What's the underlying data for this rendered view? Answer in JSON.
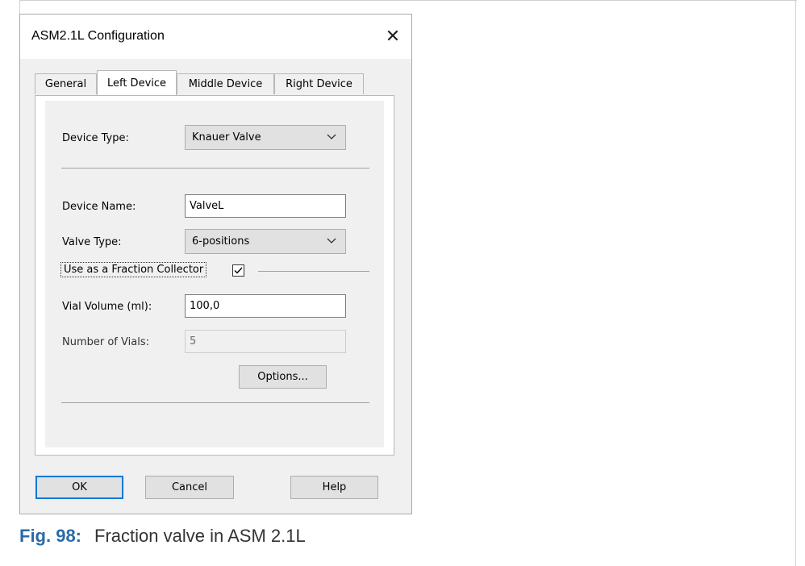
{
  "dialog": {
    "title": "ASM2.1L Configuration",
    "close_glyph": "✕"
  },
  "tabs": [
    {
      "label": "General",
      "active": false
    },
    {
      "label": "Left Device",
      "active": true
    },
    {
      "label": "Middle Device",
      "active": false
    },
    {
      "label": "Right Device",
      "active": false
    }
  ],
  "form": {
    "device_type": {
      "label": "Device Type:",
      "value": "Knauer Valve"
    },
    "device_name": {
      "label": "Device Name:",
      "value": "ValveL"
    },
    "valve_type": {
      "label": "Valve Type:",
      "value": "6-positions"
    },
    "fraction_collector": {
      "label": "Use as a Fraction Collector",
      "checked": true
    },
    "vial_volume": {
      "label": "Vial Volume (ml):",
      "value": "100,0"
    },
    "number_of_vials": {
      "label": "Number of Vials:",
      "value": "5",
      "disabled": true
    },
    "options_label": "Options..."
  },
  "buttons": {
    "ok": "OK",
    "cancel": "Cancel",
    "help": "Help"
  },
  "caption": {
    "number": "Fig. 98:",
    "text": "Fraction valve in ASM 2.1L"
  },
  "colors": {
    "accent": "#0078d7",
    "caption_blue": "#2b6aa6"
  },
  "icons": {
    "close": "close-icon",
    "dropdown": "chevron-down-icon",
    "check": "checkmark-icon"
  }
}
